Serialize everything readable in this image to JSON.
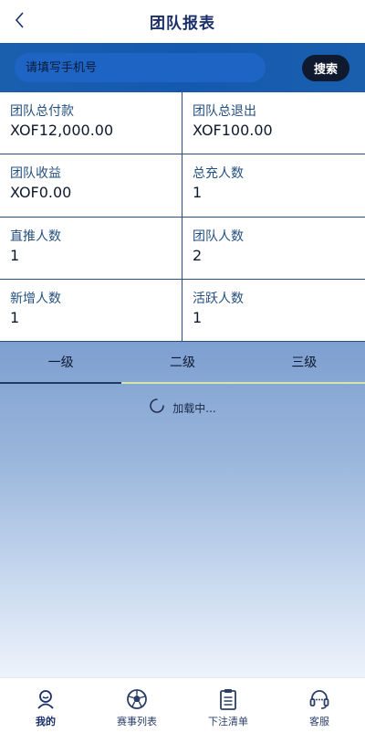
{
  "header": {
    "title": "团队报表",
    "back_icon": "chevron-left-icon"
  },
  "search": {
    "placeholder": "请填写手机号",
    "value": "",
    "button_label": "搜索"
  },
  "stats": [
    {
      "label": "团队总付款",
      "value": "XOF12,000.00"
    },
    {
      "label": "团队总退出",
      "value": "XOF100.00"
    },
    {
      "label": "团队收益",
      "value": "XOF0.00"
    },
    {
      "label": "总充人数",
      "value": "1"
    },
    {
      "label": "直推人数",
      "value": "1"
    },
    {
      "label": "团队人数",
      "value": "2"
    },
    {
      "label": "新增人数",
      "value": "1"
    },
    {
      "label": "活跃人数",
      "value": "1"
    }
  ],
  "tabs": [
    {
      "label": "一级",
      "active": true
    },
    {
      "label": "二级",
      "active": false
    },
    {
      "label": "三级",
      "active": false
    }
  ],
  "loading": {
    "text": "加载中..."
  },
  "nav": [
    {
      "label": "我的",
      "icon": "user-icon",
      "active": true
    },
    {
      "label": "赛事列表",
      "icon": "soccer-ball-icon",
      "active": false
    },
    {
      "label": "下注清单",
      "icon": "clipboard-icon",
      "active": false
    },
    {
      "label": "客服",
      "icon": "headset-icon",
      "active": false
    }
  ],
  "colors": {
    "primary": "#1b2f6b",
    "search_bar": "#1459ae",
    "button": "#0f1a2e"
  }
}
